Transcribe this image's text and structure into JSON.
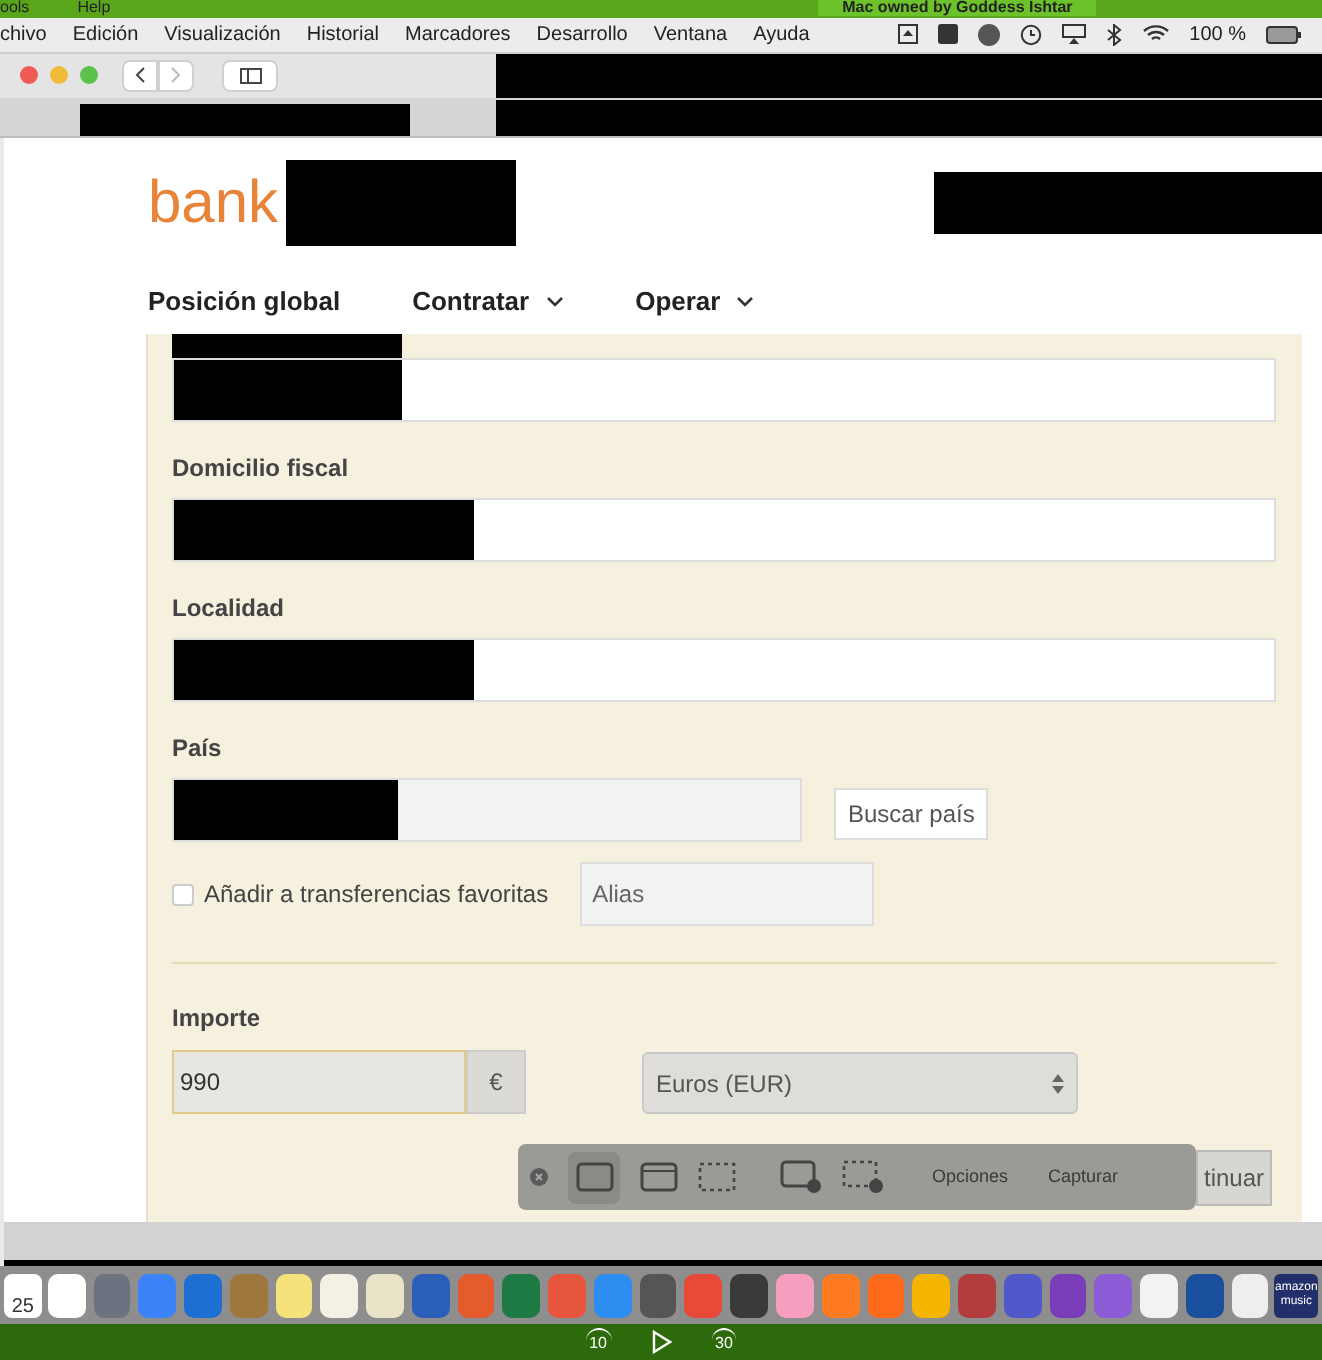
{
  "top_strip": {
    "menu": [
      "ools",
      "Help"
    ],
    "label": "Mac owned by Goddess Ishtar"
  },
  "menu_bar": {
    "items": [
      "chivo",
      "Edición",
      "Visualización",
      "Historial",
      "Marcadores",
      "Desarrollo",
      "Ventana",
      "Ayuda"
    ],
    "battery": "100 %"
  },
  "page": {
    "logo": "bank",
    "nav": [
      {
        "label": "Posición global",
        "dropdown": false
      },
      {
        "label": "Contratar",
        "dropdown": true
      },
      {
        "label": "Operar",
        "dropdown": true
      }
    ]
  },
  "form": {
    "fields": [
      {
        "kind": "unlabeled"
      },
      {
        "kind": "labeled",
        "label": "Domicilio fiscal"
      },
      {
        "kind": "labeled",
        "label": "Localidad"
      }
    ],
    "country": {
      "label": "País",
      "button": "Buscar país"
    },
    "favorite": {
      "label": "Añadir a transferencias favoritas",
      "checked": false,
      "alias_placeholder": "Alias"
    },
    "amount": {
      "label": "Importe",
      "value": "990",
      "currency_symbol": "€",
      "currency": "Euros (EUR)"
    },
    "continue_button": "tinuar"
  },
  "capture_toolbar": {
    "options": "Opciones",
    "capture": "Capturar"
  },
  "dock": {
    "calendar_day": "25",
    "music_label": "amazon music"
  },
  "player": {
    "rewind": "10",
    "forward": "30"
  }
}
